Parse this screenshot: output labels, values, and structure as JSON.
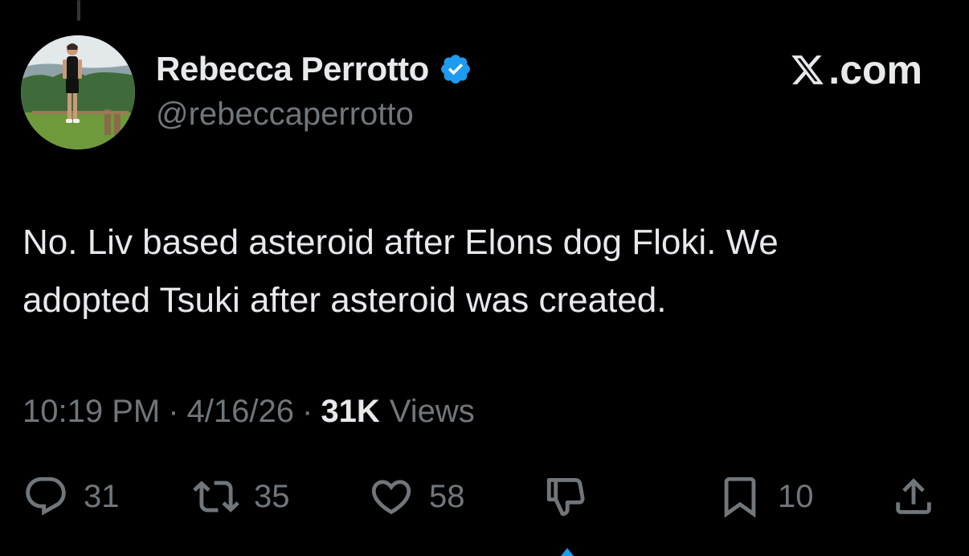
{
  "author": {
    "display_name": "Rebecca Perrotto",
    "handle": "@rebeccaperrotto",
    "verified": true,
    "avatar_icon": "profile-photo"
  },
  "brand": {
    "logo_icon": "x-logo-icon",
    "label": ".com"
  },
  "tweet": {
    "text": "No. Liv based asteroid after Elons dog Floki. We\nadopted Tsuki after asteroid was created."
  },
  "meta": {
    "time": "10:19 PM",
    "separator": "·",
    "date": "4/16/26",
    "views_count": "31K",
    "views_label": "Views"
  },
  "actions": {
    "replies": "31",
    "reposts": "35",
    "likes": "58",
    "bookmarks": "10"
  },
  "colors": {
    "background": "#000000",
    "text_primary": "#e7e9ea",
    "text_secondary": "#71767b",
    "verified_blue": "#1d9bf0"
  }
}
